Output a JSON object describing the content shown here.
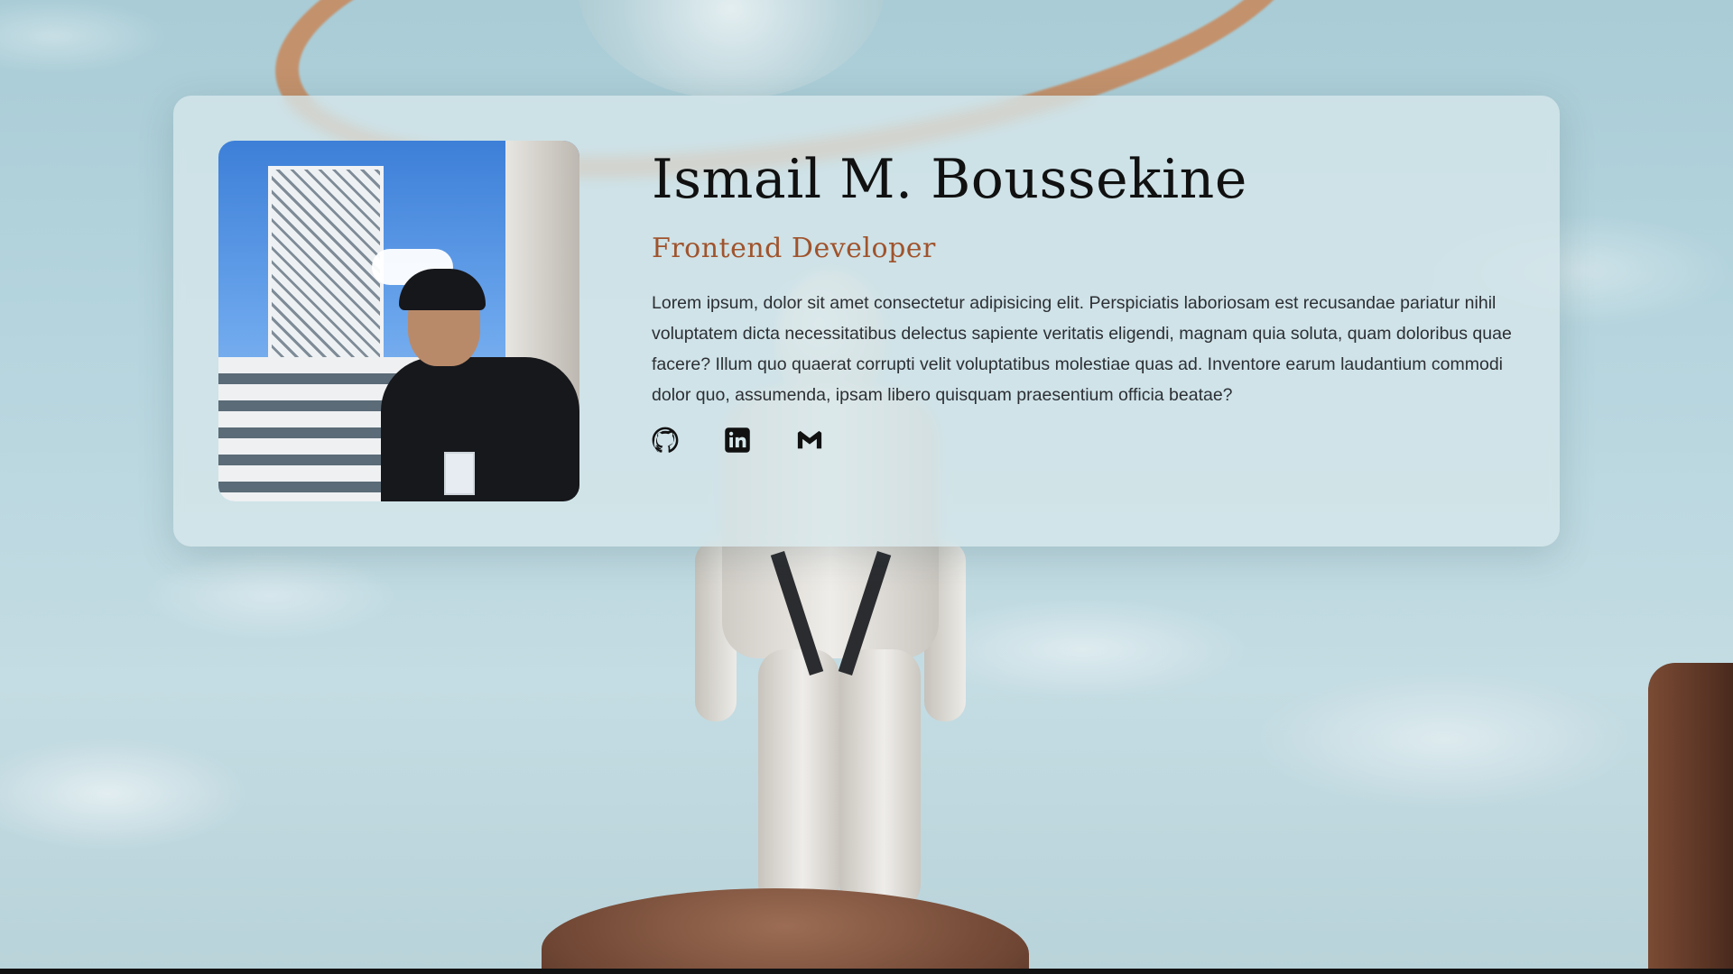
{
  "profile": {
    "name": "Ismail M. Boussekine",
    "role": "Frontend Developer",
    "bio": "Lorem ipsum, dolor sit amet consectetur adipisicing elit. Perspiciatis laboriosam est recusandae pariatur nihil voluptatem dicta necessitatibus delectus sapiente veritatis eligendi, magnam quia soluta, quam doloribus quae facere? Illum quo quaerat corrupti velit voluptatibus molestiae quas ad. Inventore earum laudantium commodi dolor quo, assumenda, ipsam libero quisquam praesentium officia beatae?"
  },
  "socials": [
    {
      "icon": "github-icon"
    },
    {
      "icon": "linkedin-icon"
    },
    {
      "icon": "gmail-icon"
    }
  ],
  "colors": {
    "role_accent": "#a0532c",
    "name_text": "#111111",
    "card_bg": "#d6e7eb"
  }
}
